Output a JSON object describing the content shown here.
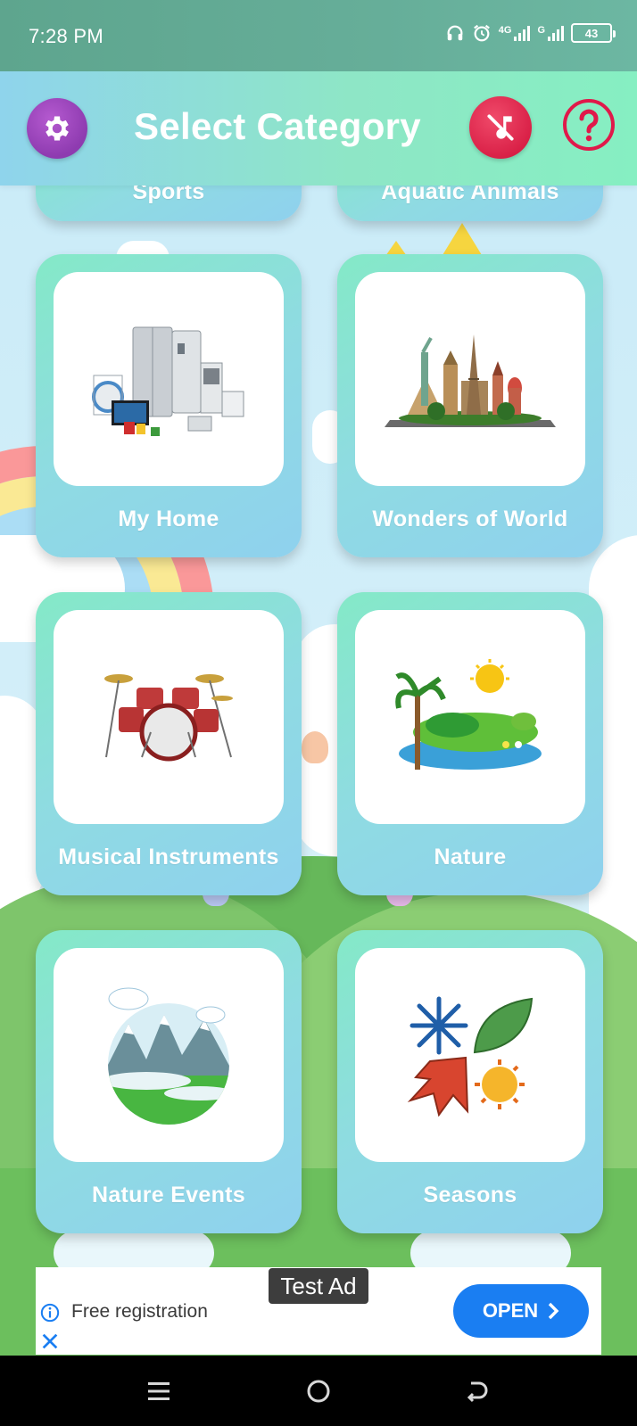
{
  "status_bar": {
    "time": "7:28 PM",
    "network1": "4G",
    "network2": "G",
    "battery": "43"
  },
  "header": {
    "title": "Select Category",
    "settings_icon": "gear-icon",
    "music_icon": "music-off-icon",
    "help_icon": "help-icon",
    "colors": {
      "settings": "#8e3bb0",
      "music": "#d81e45",
      "help": "#e0194a"
    }
  },
  "categories": [
    {
      "label": "Sports",
      "icon": "sports-icon"
    },
    {
      "label": "Aquatic Animals",
      "icon": "aquatic-animals-icon"
    },
    {
      "label": "My Home",
      "icon": "home-appliances-icon"
    },
    {
      "label": "Wonders of World",
      "icon": "world-landmarks-icon"
    },
    {
      "label": "Musical Instruments",
      "icon": "drum-kit-icon"
    },
    {
      "label": "Nature",
      "icon": "nature-island-icon"
    },
    {
      "label": "Nature Events",
      "icon": "mountain-landscape-icon"
    },
    {
      "label": "Seasons",
      "icon": "four-seasons-icon"
    }
  ],
  "ad": {
    "tag": "Test Ad",
    "text": "Free registration",
    "button": "OPEN"
  }
}
